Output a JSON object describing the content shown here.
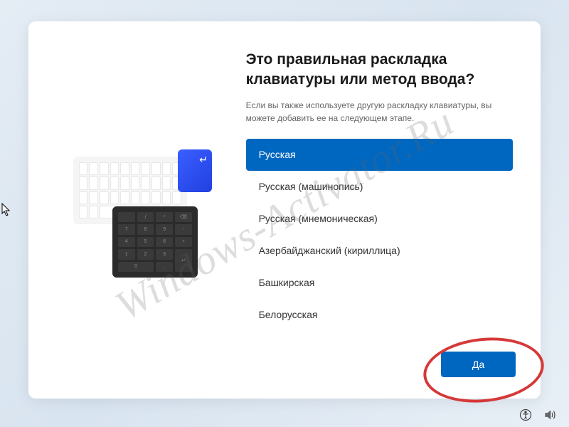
{
  "heading": "Это правильная раскладка клавиатуры или метод ввода?",
  "subtext": "Если вы также используете другую раскладку клавиатуры, вы можете добавить ее на следующем этапе.",
  "layouts": [
    {
      "label": "Русская",
      "selected": true
    },
    {
      "label": "Русская (машинопись)",
      "selected": false
    },
    {
      "label": "Русская (мнемоническая)",
      "selected": false
    },
    {
      "label": "Азербайджанский (кириллица)",
      "selected": false
    },
    {
      "label": "Башкирская",
      "selected": false
    },
    {
      "label": "Белорусская",
      "selected": false
    }
  ],
  "primary_button": "Да",
  "watermark": "Windows-Activator.Ru",
  "colors": {
    "accent": "#0067c0",
    "annotation": "#d63838"
  }
}
